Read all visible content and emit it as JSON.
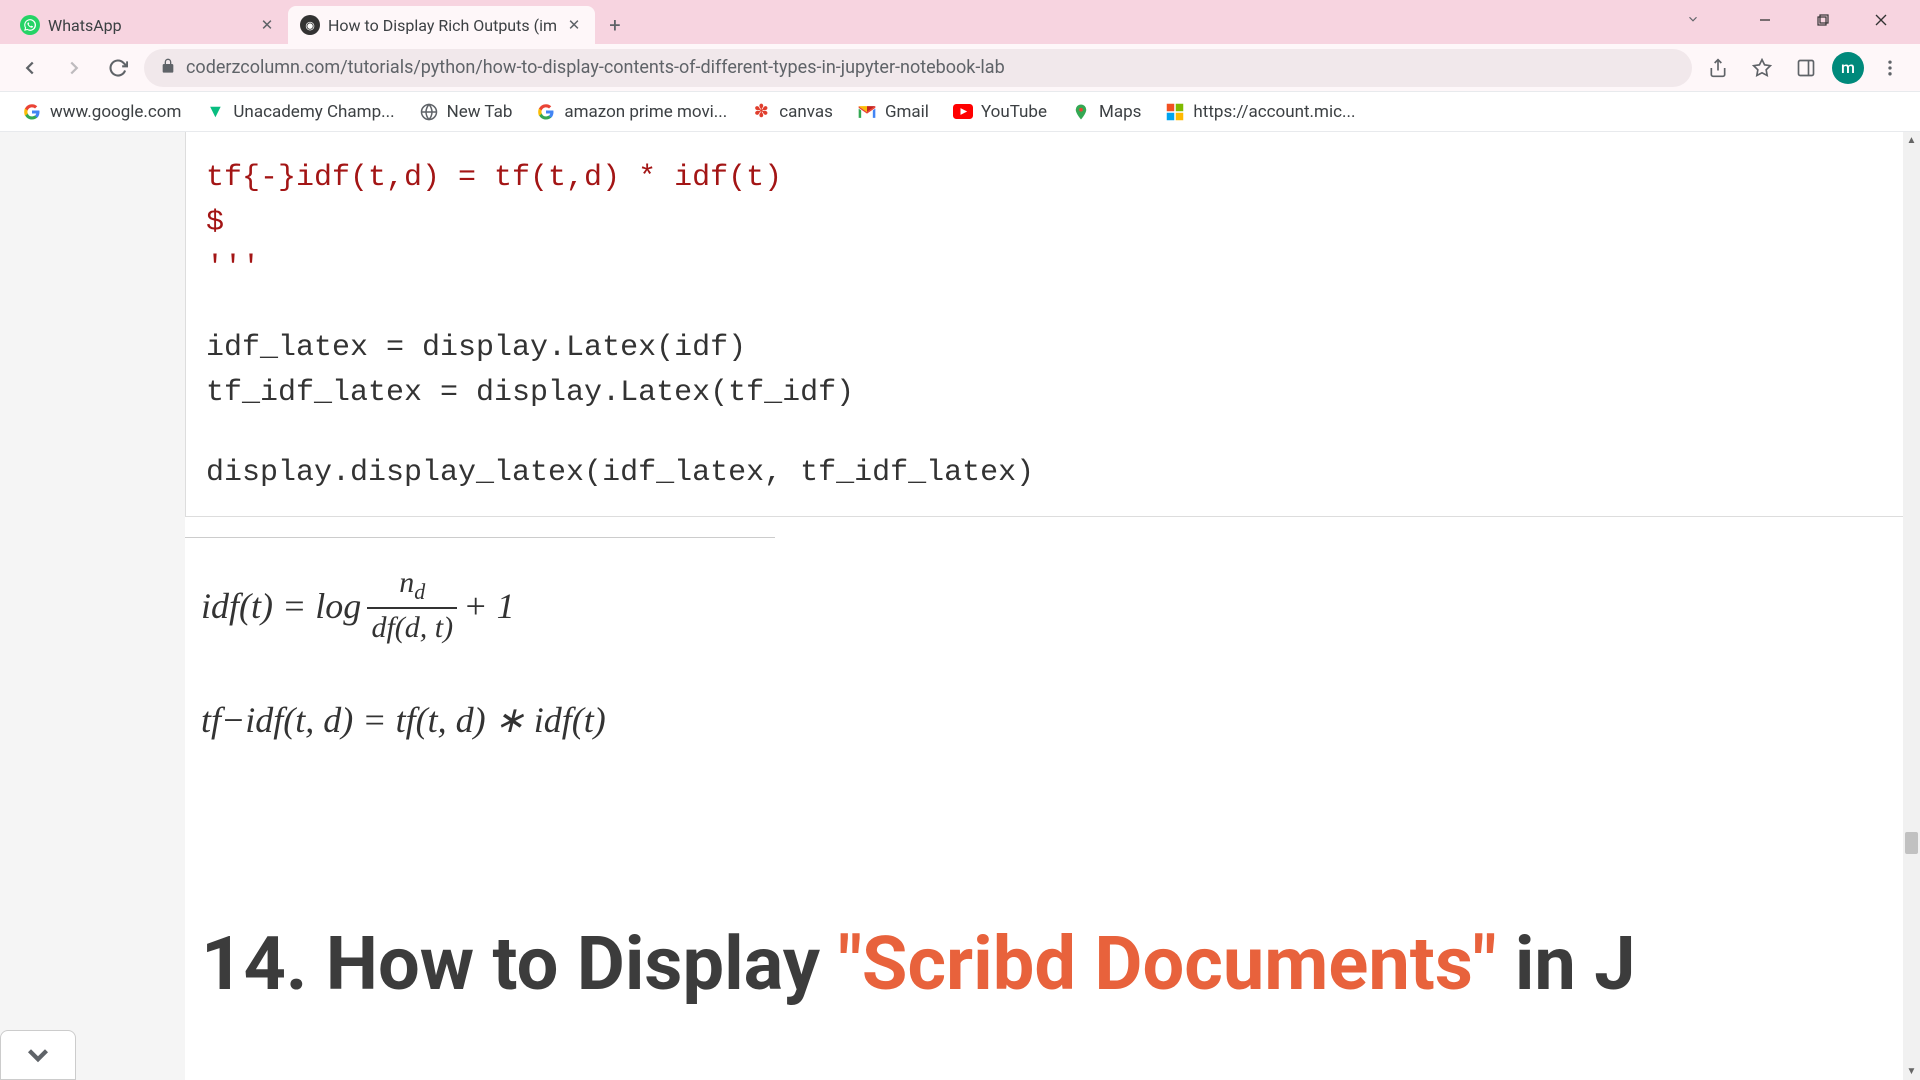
{
  "browser": {
    "tabs": [
      {
        "title": "WhatsApp",
        "active": false
      },
      {
        "title": "How to Display Rich Outputs (im",
        "active": true
      }
    ],
    "url": "coderzcolumn.com/tutorials/python/how-to-display-contents-of-different-types-in-jupyter-notebook-lab",
    "avatar_letter": "m"
  },
  "bookmarks": [
    {
      "label": "www.google.com",
      "icon": "google"
    },
    {
      "label": "Unacademy Champ...",
      "icon": "unacademy"
    },
    {
      "label": "New Tab",
      "icon": "globe"
    },
    {
      "label": "amazon prime movi...",
      "icon": "google"
    },
    {
      "label": "canvas",
      "icon": "canvas"
    },
    {
      "label": "Gmail",
      "icon": "gmail"
    },
    {
      "label": "YouTube",
      "icon": "youtube"
    },
    {
      "label": "Maps",
      "icon": "maps"
    },
    {
      "label": "https://account.mic...",
      "icon": "microsoft"
    }
  ],
  "code": {
    "line1": "tf{-}idf(t,d) = tf(t,d) * idf(t)",
    "line2": "$",
    "line3": "'''",
    "line4": "idf_latex = display.Latex(idf)",
    "line5": "tf_idf_latex = display.Latex(tf_idf)",
    "line6": "display.display_latex(idf_latex, tf_idf_latex)"
  },
  "output": {
    "formula1_lhs": "idf(t) = log",
    "formula1_num_var": "n",
    "formula1_num_sub": "d",
    "formula1_den": "df(d, t)",
    "formula1_tail": "+ 1",
    "formula2": "tf−idf(t, d) = tf(t, d) ∗ idf(t)"
  },
  "heading": {
    "prefix": "14. How to Display ",
    "highlight": "\"Scribd Documents\"",
    "suffix": " in J"
  }
}
